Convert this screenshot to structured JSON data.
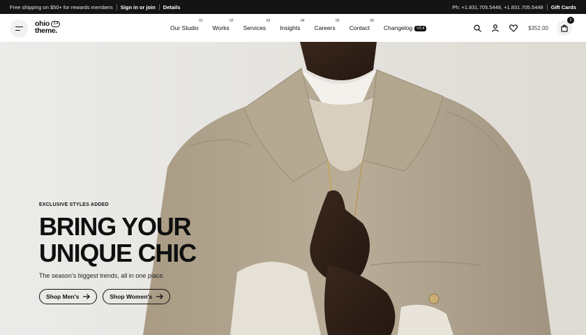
{
  "topbar": {
    "promo": "Free shipping on $50+ for rewards members",
    "signin": "Sign in or join",
    "details": "Details",
    "phone": "Ph: +1.831.705.5448, +1.831.705.5448",
    "gift_cards": "Gift Cards"
  },
  "logo": {
    "line1": "ohio",
    "line2": "theme.",
    "version": "3.4"
  },
  "nav": [
    {
      "label": "Our Studio",
      "num": "01"
    },
    {
      "label": "Works",
      "num": "02"
    },
    {
      "label": "Services",
      "num": "03"
    },
    {
      "label": "Insights",
      "num": "04"
    },
    {
      "label": "Careers",
      "num": "05"
    },
    {
      "label": "Contact",
      "num": "06"
    },
    {
      "label": "Changelog",
      "badge": "V3.4"
    }
  ],
  "header": {
    "cart_total": "$352.00",
    "cart_count": "2"
  },
  "hero": {
    "eyebrow": "EXCLUSIVE STYLES ADDED",
    "headline_1": "BRING YOUR",
    "headline_2": "UNIQUE CHIC",
    "subtitle": "The season's biggest trends, all in one place.",
    "cta_men": "Shop Men's",
    "cta_women": "Shop Women's"
  },
  "icons": [
    "menu-icon",
    "search-icon",
    "user-icon",
    "heart-icon",
    "bag-icon",
    "arrow-right-icon"
  ],
  "colors": {
    "topbar_bg": "#141414",
    "coat": "#b2a58f",
    "background": "#e8e7e3"
  }
}
